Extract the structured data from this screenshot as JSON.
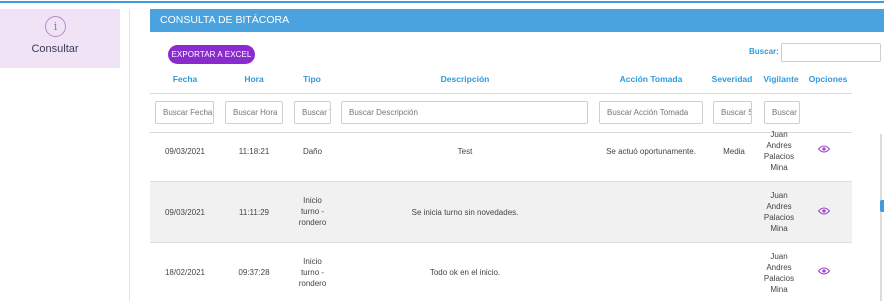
{
  "sidebar": {
    "item_label": "Consultar",
    "icon": "info-icon",
    "icon_glyph": "i"
  },
  "panel": {
    "title": "CONSULTA DE BITÁCORA"
  },
  "toolbar": {
    "export_label": "EXPORTAR A EXCEL",
    "search_label": "Buscar:",
    "search_value": ""
  },
  "columns": [
    "Fecha",
    "Hora",
    "Tipo",
    "Descripción",
    "Acción Tomada",
    "Severidad",
    "Vigilante",
    "Opciones"
  ],
  "filters": [
    "Buscar Fecha",
    "Buscar Hora",
    "Buscar Tipo",
    "Buscar Descripción",
    "Buscar Acción Tomada",
    "Buscar Severidad",
    "Buscar Vigilante"
  ],
  "rows": [
    {
      "fecha": "09/03/2021",
      "hora": "11:18:21",
      "tipo": [
        "Daño"
      ],
      "descripcion": "Test",
      "accion": "Se actuó oportunamente.",
      "severidad": "Media",
      "vigilante": [
        "Juan",
        "Andres",
        "Palacios",
        "Mina"
      ],
      "option_icon": "eye-icon"
    },
    {
      "fecha": "09/03/2021",
      "hora": "11:11:29",
      "tipo": [
        "Inicio",
        "turno -",
        "rondero"
      ],
      "descripcion": "Se inicia turno sin novedades.",
      "accion": "",
      "severidad": "",
      "vigilante": [
        "Juan",
        "Andres",
        "Palacios",
        "Mina"
      ],
      "option_icon": "eye-icon"
    },
    {
      "fecha": "18/02/2021",
      "hora": "09:37:28",
      "tipo": [
        "Inicio",
        "turno -",
        "rondero"
      ],
      "descripcion": "Todo ok en el inicio.",
      "accion": "",
      "severidad": "",
      "vigilante": [
        "Juan",
        "Andres",
        "Palacios",
        "Mina"
      ],
      "option_icon": "eye-icon"
    }
  ],
  "colors": {
    "accent_blue": "#4aa2de",
    "button_purple": "#8a2bd0",
    "sidebar_bg": "#efe3f5",
    "eye_purple": "#a23fd6"
  }
}
